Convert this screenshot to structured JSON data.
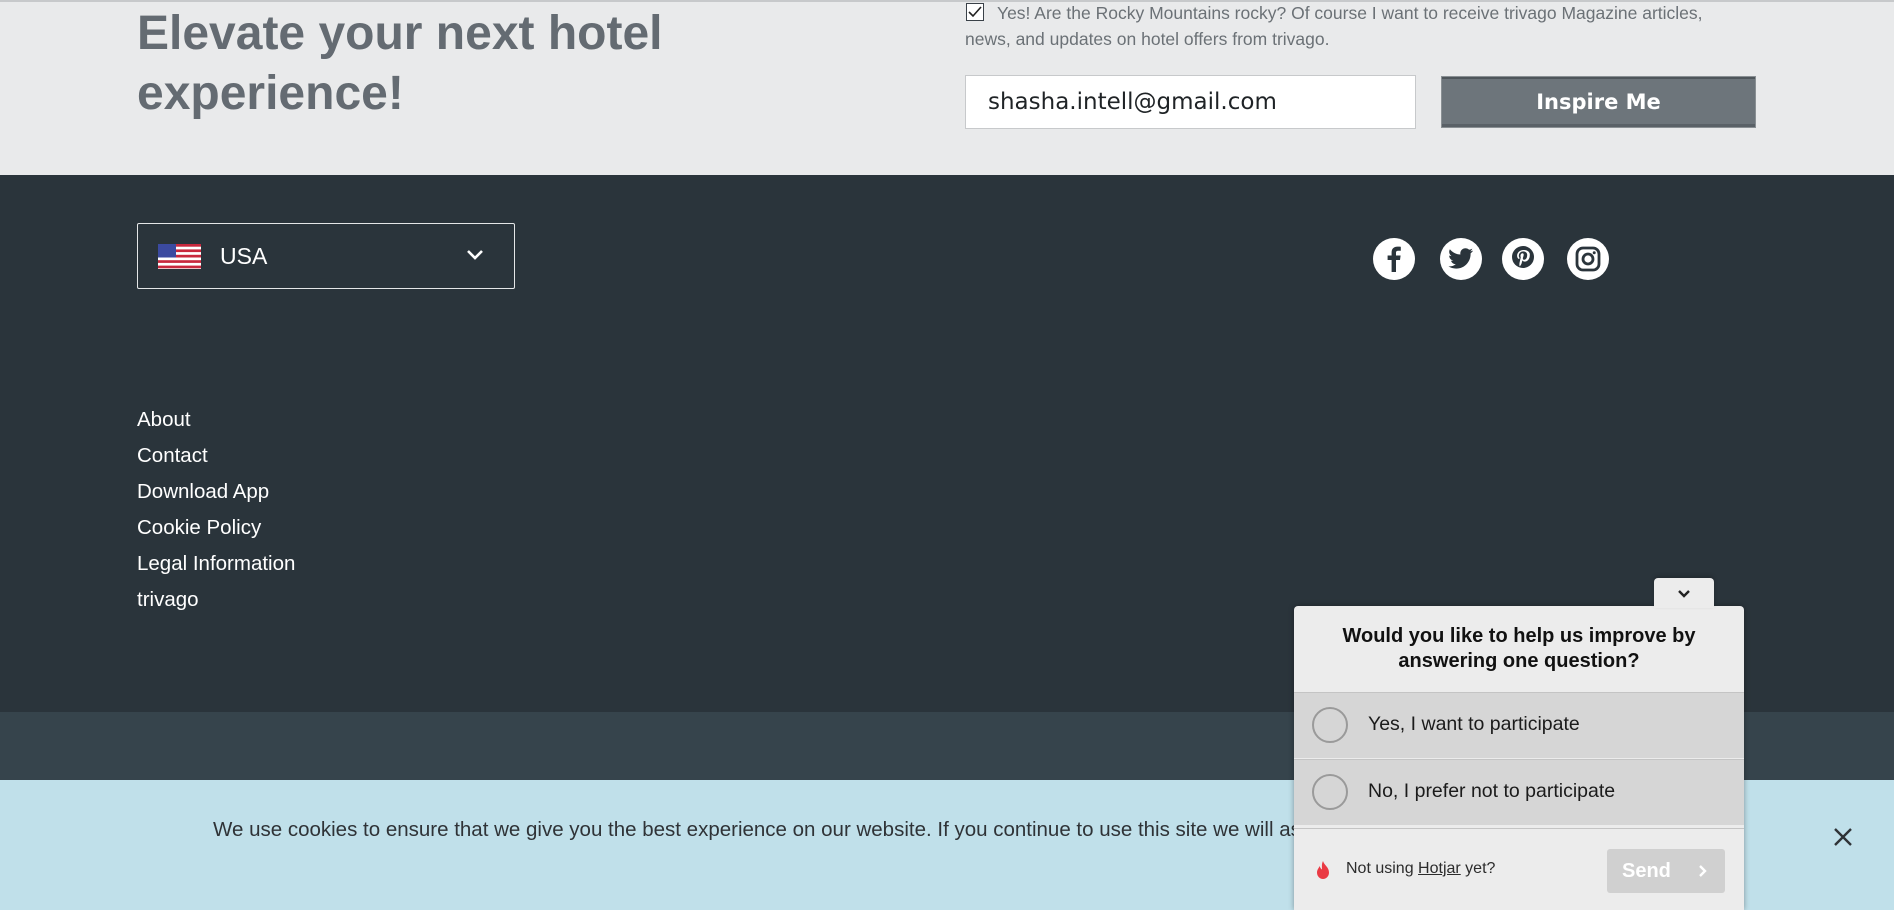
{
  "newsletter": {
    "headline": "Elevate your next hotel experience!",
    "consent_text": "Yes! Are the Rocky Mountains rocky? Of course I want to receive trivago Magazine articles, news, and updates on hotel offers from trivago.",
    "consent_checked": true,
    "email_value": "shasha.intell@gmail.com",
    "submit_label": "Inspire Me"
  },
  "footer": {
    "country_label": "USA",
    "social": [
      "facebook-icon",
      "twitter-icon",
      "pinterest-icon",
      "instagram-icon"
    ],
    "links": [
      "About",
      "Contact",
      "Download App",
      "Cookie Policy",
      "Legal Information",
      "trivago"
    ]
  },
  "cookie_banner": {
    "text": "We use cookies to ensure that we give you the best experience on our website. If you continue to use this site we will assume that you are happy with it."
  },
  "survey": {
    "question": "Would you like to help us improve by answering one question?",
    "options": [
      "Yes, I want to participate",
      "No, I prefer not to participate"
    ],
    "footer_prefix": "Not using ",
    "footer_link": "Hotjar",
    "footer_suffix": " yet?",
    "send_label": "Send"
  },
  "colors": {
    "top_band": "#e9eaeb",
    "footer_dark": "#2a343b",
    "cookie_bg": "#c0e0ea",
    "button_gray": "#6d757b"
  }
}
